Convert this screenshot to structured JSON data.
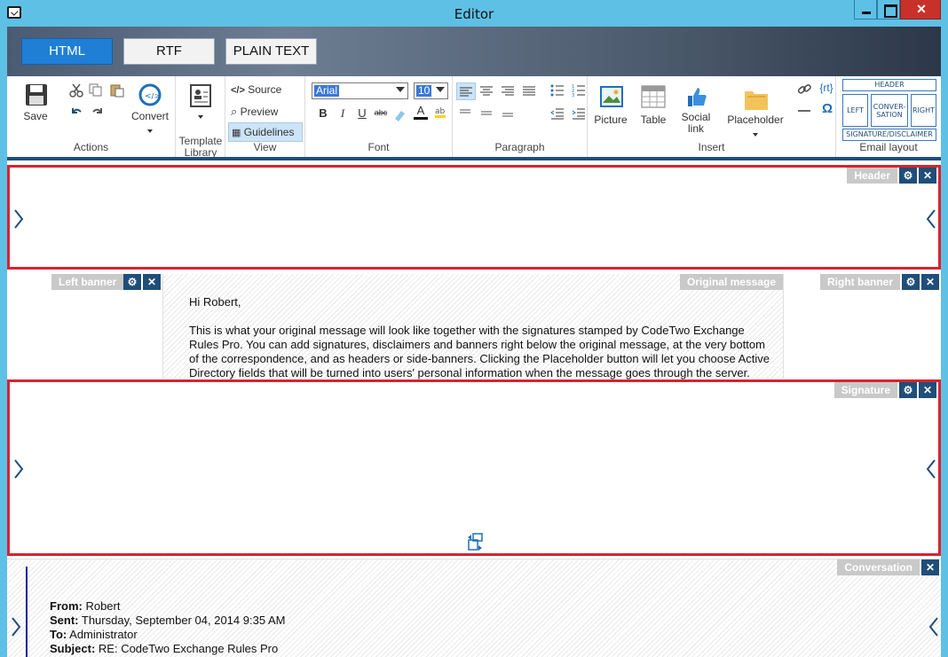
{
  "window": {
    "title": "Editor"
  },
  "format_tabs": [
    "HTML",
    "RTF",
    "PLAIN TEXT"
  ],
  "ribbon": {
    "actions": {
      "save": "Save",
      "convert": "Convert",
      "label": "Actions"
    },
    "template": {
      "label_line1": "Template",
      "label_line2": "Library"
    },
    "view": {
      "source": "Source",
      "preview": "Preview",
      "guidelines": "Guidelines",
      "label": "View"
    },
    "font": {
      "family": "Arial",
      "size": "10",
      "label": "Font"
    },
    "paragraph": {
      "label": "Paragraph"
    },
    "insert": {
      "picture": "Picture",
      "table": "Table",
      "social_line1": "Social",
      "social_line2": "link",
      "placeholder": "Placeholder",
      "rt": "{rt}",
      "label": "Insert"
    },
    "email_layout": {
      "header": "HEADER",
      "left": "LEFT",
      "conv_line1": "CONVER-",
      "conv_line2": "SATION",
      "right": "RIGHT",
      "sig": "SIGNATURE/DISCLAIMER",
      "label": "Email layout"
    }
  },
  "zones": {
    "header": "Header",
    "left_banner": "Left banner",
    "original_message": "Original message",
    "right_banner": "Right banner",
    "signature": "Signature",
    "conversation": "Conversation"
  },
  "original_message": {
    "greeting": "Hi Robert,",
    "lines": [
      "This is what your original message will look like together with the signatures stamped by CodeTwo Exchange",
      "Rules Pro. You can add signatures, disclaimers and banners right below the original message, at the very bottom",
      "of the correspondence, and as headers or side-banners. Clicking the Placeholder button will let you choose Active",
      "Directory fields that will be turned into users' personal information when the message goes through the server."
    ]
  },
  "conversation": {
    "from_label": "From:",
    "from": " Robert",
    "sent_label": "Sent:",
    "sent": " Thursday, September 04, 2014 9:35 AM",
    "to_label": "To:",
    "to": " Administrator",
    "subject_label": "Subject:",
    "subject": " RE: CodeTwo Exchange Rules Pro"
  },
  "colors": {
    "accent": "#1e7fd4",
    "zone_border": "#d9232d",
    "zone_button": "#1f4e79",
    "titlebar": "#5fc0e6"
  }
}
